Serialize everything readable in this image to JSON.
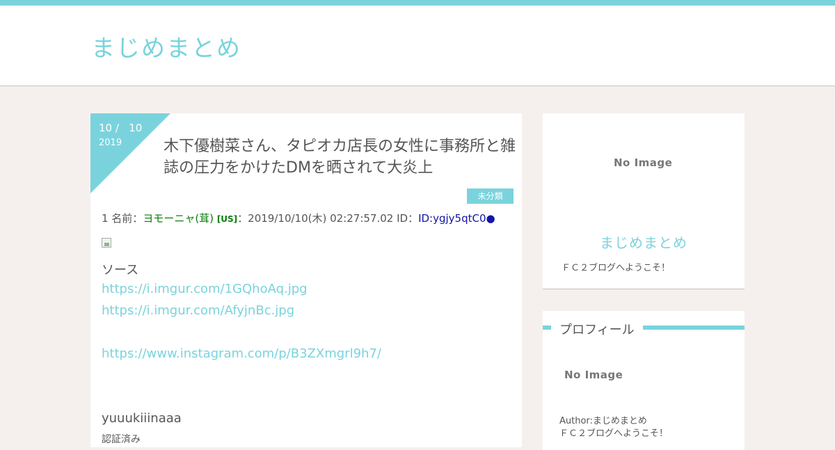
{
  "site": {
    "title": "まじめまとめ"
  },
  "colors": {
    "accent": "#7ad3dc",
    "background": "#f5f0ed",
    "name": "#0a7d0a",
    "id": "#1414a8"
  },
  "post": {
    "date_md": "10 /   10",
    "date_year": "2019",
    "title": "木下優樹菜さん、タピオカ店長の女性に事務所と雑誌の圧力をかけたDMを晒されて大炎上",
    "category": "未分類",
    "res": {
      "number_label": "1 名前：",
      "name": "ヨモーニャ(茸)",
      "flag": "[US]",
      "datetime": "：2019/10/10(木) 02:27:57.02 ID：",
      "id": "ID:ygjy5qtC0●"
    },
    "source_label": "ソース",
    "links": [
      "https://i.imgur.com/1GQhoAq.jpg",
      "https://i.imgur.com/AfyjnBc.jpg",
      "https://www.instagram.com/p/B3ZXmgrl9h7/"
    ],
    "username": "yuuukiiinaaa",
    "trailing": "認証済み"
  },
  "sidebar": {
    "card1": {
      "noimage": "No Image",
      "title": "まじめまとめ",
      "desc": "ＦＣ２ブログへようこそ！"
    },
    "profile": {
      "heading": "プロフィール",
      "noimage": "No Image",
      "author": "Author:まじめまとめ",
      "desc": "ＦＣ２ブログへようこそ！"
    }
  }
}
